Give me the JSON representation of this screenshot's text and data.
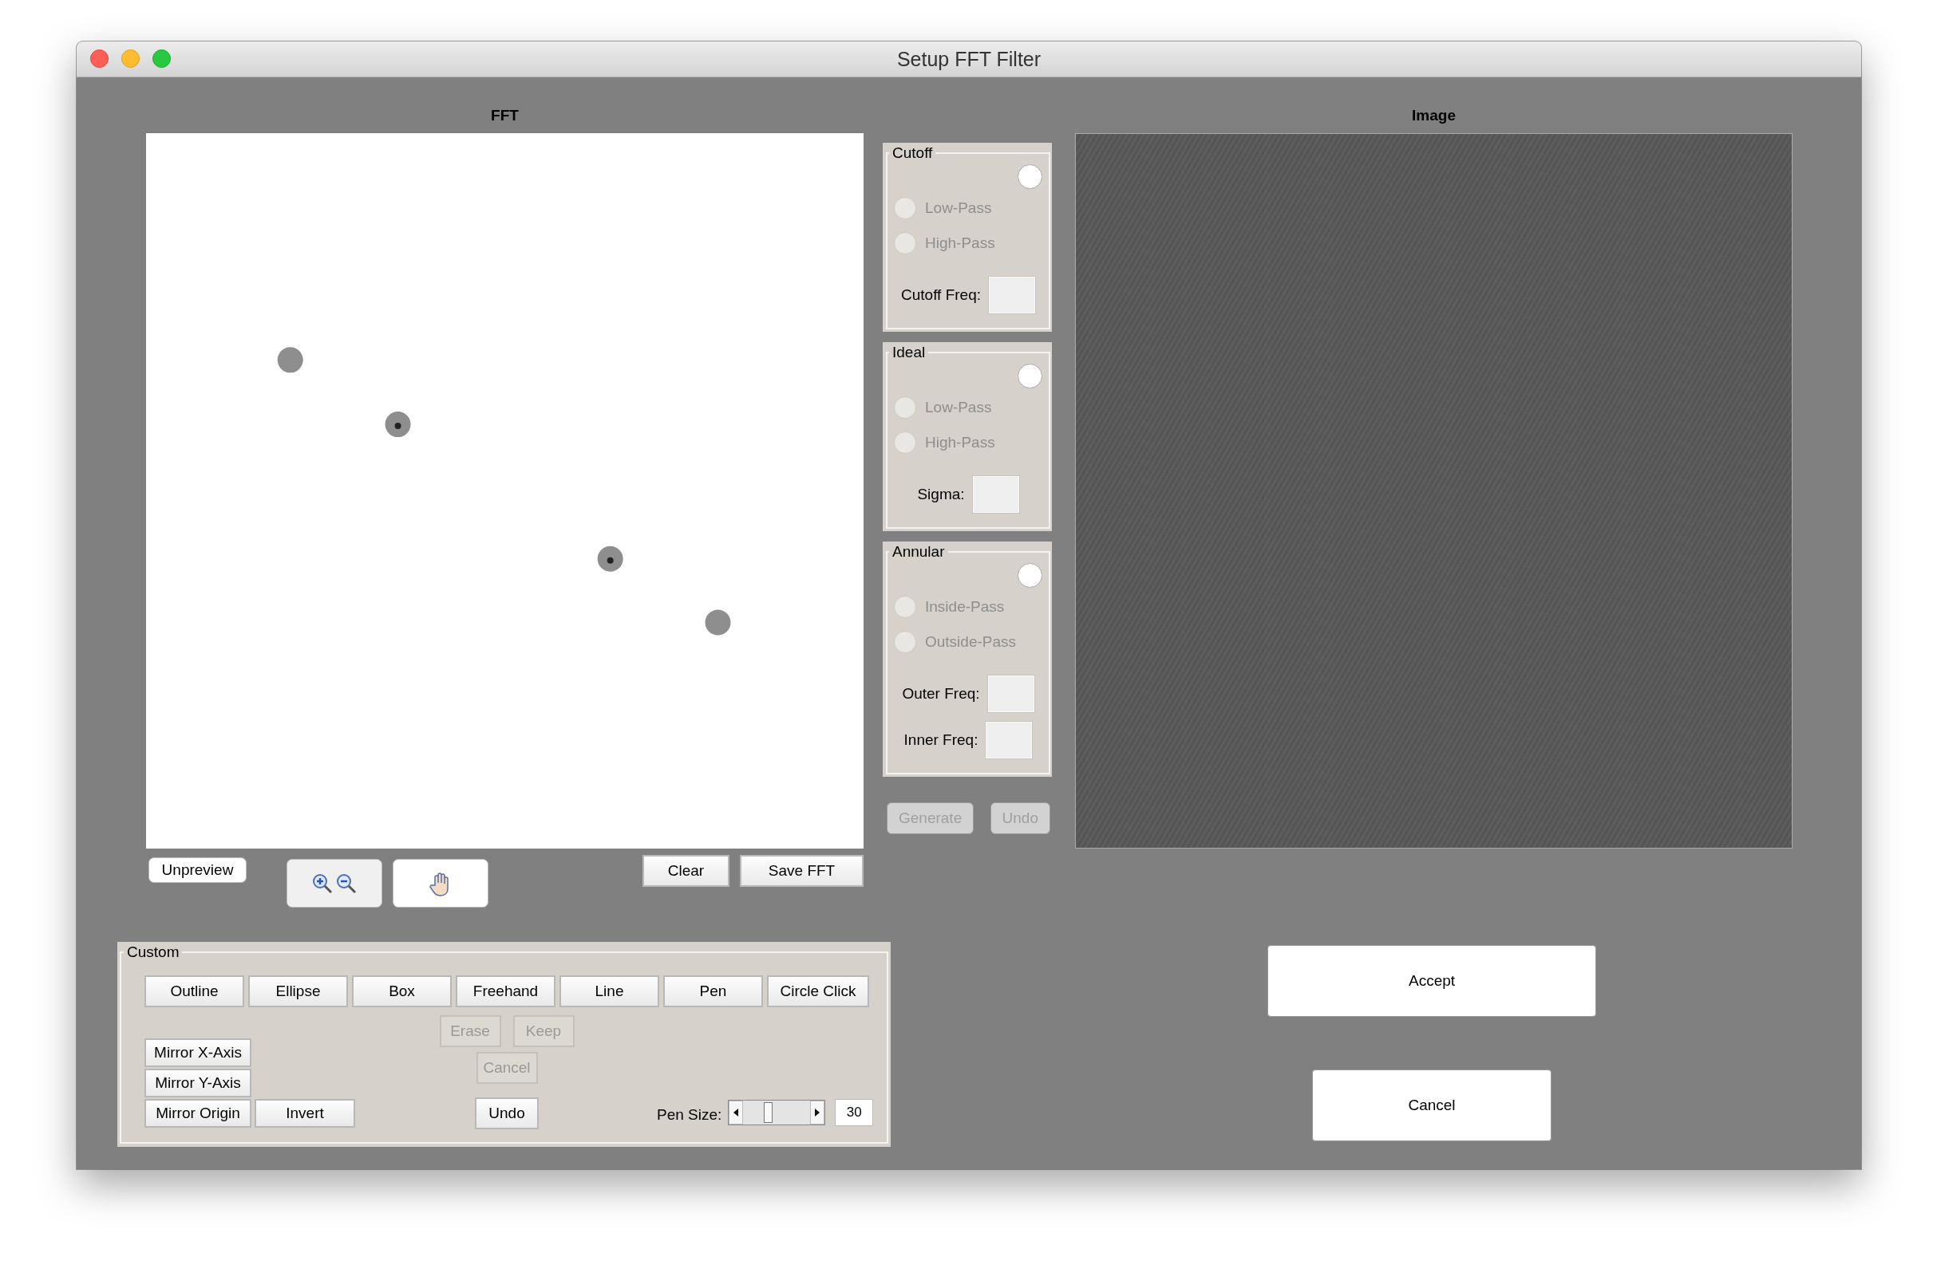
{
  "window": {
    "title": "Setup FFT Filter"
  },
  "fft_panel": {
    "title": "FFT",
    "unpreview": "Unpreview",
    "clear": "Clear",
    "save": "Save FFT"
  },
  "filter_groups": [
    {
      "title": "Cutoff",
      "selector": {
        "selected": false
      },
      "options": [
        {
          "label": "Low-Pass",
          "selected": false,
          "disabled": true
        },
        {
          "label": "High-Pass",
          "selected": false,
          "disabled": true
        }
      ],
      "fields": [
        {
          "label": "Cutoff Freq:"
        }
      ]
    },
    {
      "title": "Ideal",
      "selector": {
        "selected": false
      },
      "options": [
        {
          "label": "Low-Pass",
          "selected": false,
          "disabled": true
        },
        {
          "label": "High-Pass",
          "selected": false,
          "disabled": true
        }
      ],
      "fields": [
        {
          "label": "Sigma:"
        }
      ]
    },
    {
      "title": "Annular",
      "selector": {
        "selected": false
      },
      "options": [
        {
          "label": "Inside-Pass",
          "selected": false,
          "disabled": true
        },
        {
          "label": "Outside-Pass",
          "selected": false,
          "disabled": true
        }
      ],
      "fields": [
        {
          "label": "Outer Freq:"
        },
        {
          "label": "Inner Freq:"
        }
      ]
    }
  ],
  "filter_buttons": [
    {
      "label": "Generate",
      "disabled": true
    },
    {
      "label": "Undo",
      "disabled": true
    }
  ],
  "image_panel": {
    "title": "Image"
  },
  "custom": {
    "title": "Custom",
    "tools": [
      {
        "label": "Outline"
      },
      {
        "label": "Ellipse"
      },
      {
        "label": "Box"
      },
      {
        "label": "Freehand"
      },
      {
        "label": "Line"
      },
      {
        "label": "Pen"
      },
      {
        "label": "Circle Click"
      }
    ],
    "edit_buttons": [
      {
        "label": "Erase",
        "disabled": true
      },
      {
        "label": "Keep",
        "disabled": true
      }
    ],
    "cancel": {
      "label": "Cancel",
      "disabled": true
    },
    "undo": {
      "label": "Undo",
      "disabled": false
    },
    "mirror_buttons": [
      {
        "label": "Mirror X-Axis"
      },
      {
        "label": "Mirror Y-Axis"
      },
      {
        "label": "Mirror Origin"
      }
    ],
    "invert": "Invert",
    "pen_size": {
      "label": "Pen Size:",
      "level": 0.35,
      "value": "30"
    }
  },
  "actions": [
    {
      "label": "Accept"
    },
    {
      "label": "Cancel"
    }
  ]
}
